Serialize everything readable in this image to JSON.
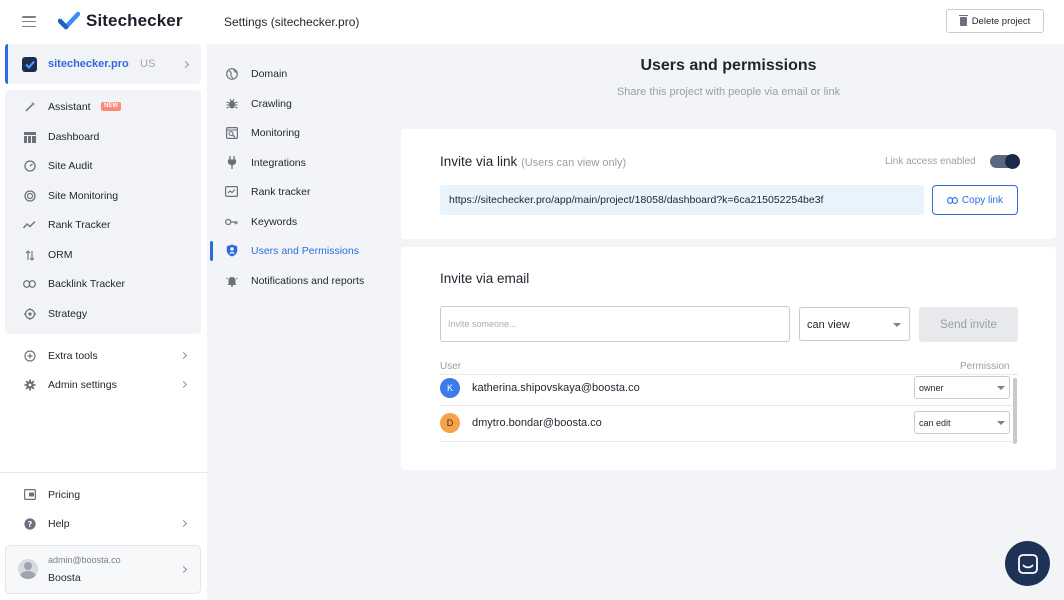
{
  "app": {
    "brand": "Sitechecker",
    "page_title": "Settings (sitechecker.pro)",
    "delete_label": "Delete project",
    "colors": {
      "accent": "#2d6be0",
      "dark": "#1e3256",
      "new_badge": "#ff8a7a"
    }
  },
  "sidebar": {
    "project": {
      "name": "sitechecker.pro",
      "country": "US"
    },
    "items": [
      {
        "label": "Assistant",
        "icon": "magic-wand-icon",
        "badge": "NEW"
      },
      {
        "label": "Dashboard",
        "icon": "dashboard-icon"
      },
      {
        "label": "Site Audit",
        "icon": "gauge-icon"
      },
      {
        "label": "Site Monitoring",
        "icon": "monitoring-icon"
      },
      {
        "label": "Rank Tracker",
        "icon": "trend-icon"
      },
      {
        "label": "ORM",
        "icon": "sort-icon"
      },
      {
        "label": "Backlink Tracker",
        "icon": "link-icon"
      },
      {
        "label": "Strategy",
        "icon": "target-icon"
      }
    ],
    "extra_tools": "Extra tools",
    "admin_settings": "Admin settings",
    "pricing": "Pricing",
    "help": "Help",
    "user": {
      "email": "admin@boosta.co",
      "name": "Boosta"
    }
  },
  "settings_menu": [
    {
      "label": "Domain",
      "icon": "globe-icon"
    },
    {
      "label": "Crawling",
      "icon": "bug-icon"
    },
    {
      "label": "Monitoring",
      "icon": "monitor-icon"
    },
    {
      "label": "Integrations",
      "icon": "plug-icon"
    },
    {
      "label": "Rank tracker",
      "icon": "rank-icon"
    },
    {
      "label": "Keywords",
      "icon": "key-icon"
    },
    {
      "label": "Users and Permissions",
      "icon": "shield-user-icon",
      "active": true
    },
    {
      "label": "Notifications and reports",
      "icon": "bell-icon"
    }
  ],
  "main": {
    "title": "Users and permissions",
    "subtitle": "Share this project with people via email or link",
    "link_card": {
      "heading": "Invite via link",
      "note": "(Users can view only)",
      "toggle_label": "Link access enabled",
      "toggle_on": true,
      "url": "https://sitechecker.pro/app/main/project/18058/dashboard?k=6ca215052254be3f",
      "copy_label": "Copy link"
    },
    "email_card": {
      "heading": "Invite via email",
      "placeholder": "Invite someone...",
      "permission": "can view",
      "send_label": "Send invite",
      "col_user": "User",
      "col_permission": "Permission",
      "users": [
        {
          "initial": "K",
          "email": "katherina.shipovskaya@boosta.co",
          "permission": "owner",
          "color": "#3d7be8"
        },
        {
          "initial": "D",
          "email": "dmytro.bondar@boosta.co",
          "permission": "can edit",
          "color": "#f5a24b"
        }
      ]
    }
  }
}
